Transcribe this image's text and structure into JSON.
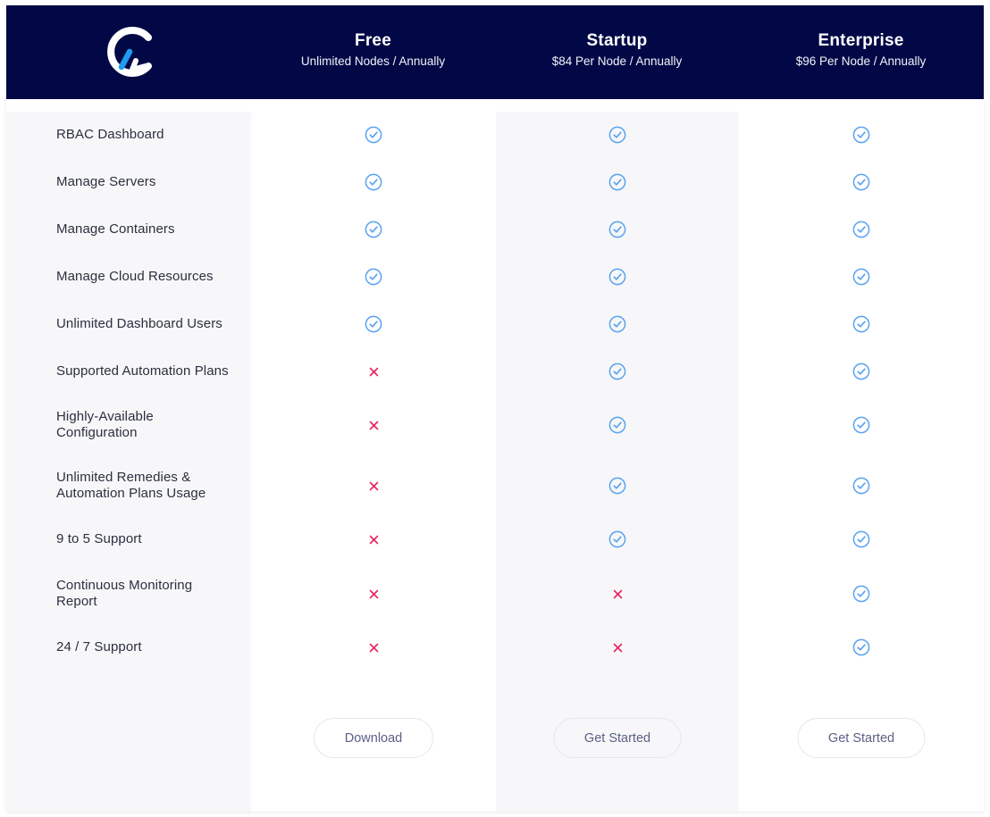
{
  "brand": {
    "logo_icon": "brand-logo-c-icon",
    "header_bg": "#020846",
    "accent": "#1e9bf0"
  },
  "plans": [
    {
      "name": "Free",
      "price": "Unlimited Nodes / Annually",
      "cta": "Download"
    },
    {
      "name": "Startup",
      "price": "$84 Per Node / Annually",
      "cta": "Get Started"
    },
    {
      "name": "Enterprise",
      "price": "$96 Per Node / Annually",
      "cta": "Get Started"
    }
  ],
  "icons": {
    "included": "check-circle-icon",
    "excluded": "cross-icon",
    "check_color": "#5aa3f0",
    "cross_color": "#e8245a"
  },
  "features": [
    {
      "label": "RBAC Dashboard",
      "free": true,
      "startup": true,
      "enterprise": true
    },
    {
      "label": "Manage Servers",
      "free": true,
      "startup": true,
      "enterprise": true
    },
    {
      "label": "Manage Containers",
      "free": true,
      "startup": true,
      "enterprise": true
    },
    {
      "label": "Manage Cloud Resources",
      "free": true,
      "startup": true,
      "enterprise": true
    },
    {
      "label": "Unlimited Dashboard Users",
      "free": true,
      "startup": true,
      "enterprise": true
    },
    {
      "label": "Supported Automation Plans",
      "free": false,
      "startup": true,
      "enterprise": true
    },
    {
      "label": "Highly-Available\nConfiguration",
      "free": false,
      "startup": true,
      "enterprise": true
    },
    {
      "label": "Unlimited Remedies &\nAutomation Plans Usage",
      "free": false,
      "startup": true,
      "enterprise": true
    },
    {
      "label": "9 to 5 Support",
      "free": false,
      "startup": true,
      "enterprise": true
    },
    {
      "label": "Continuous Monitoring\nReport",
      "free": false,
      "startup": false,
      "enterprise": true
    },
    {
      "label": "24 / 7 Support",
      "free": false,
      "startup": false,
      "enterprise": true
    }
  ]
}
